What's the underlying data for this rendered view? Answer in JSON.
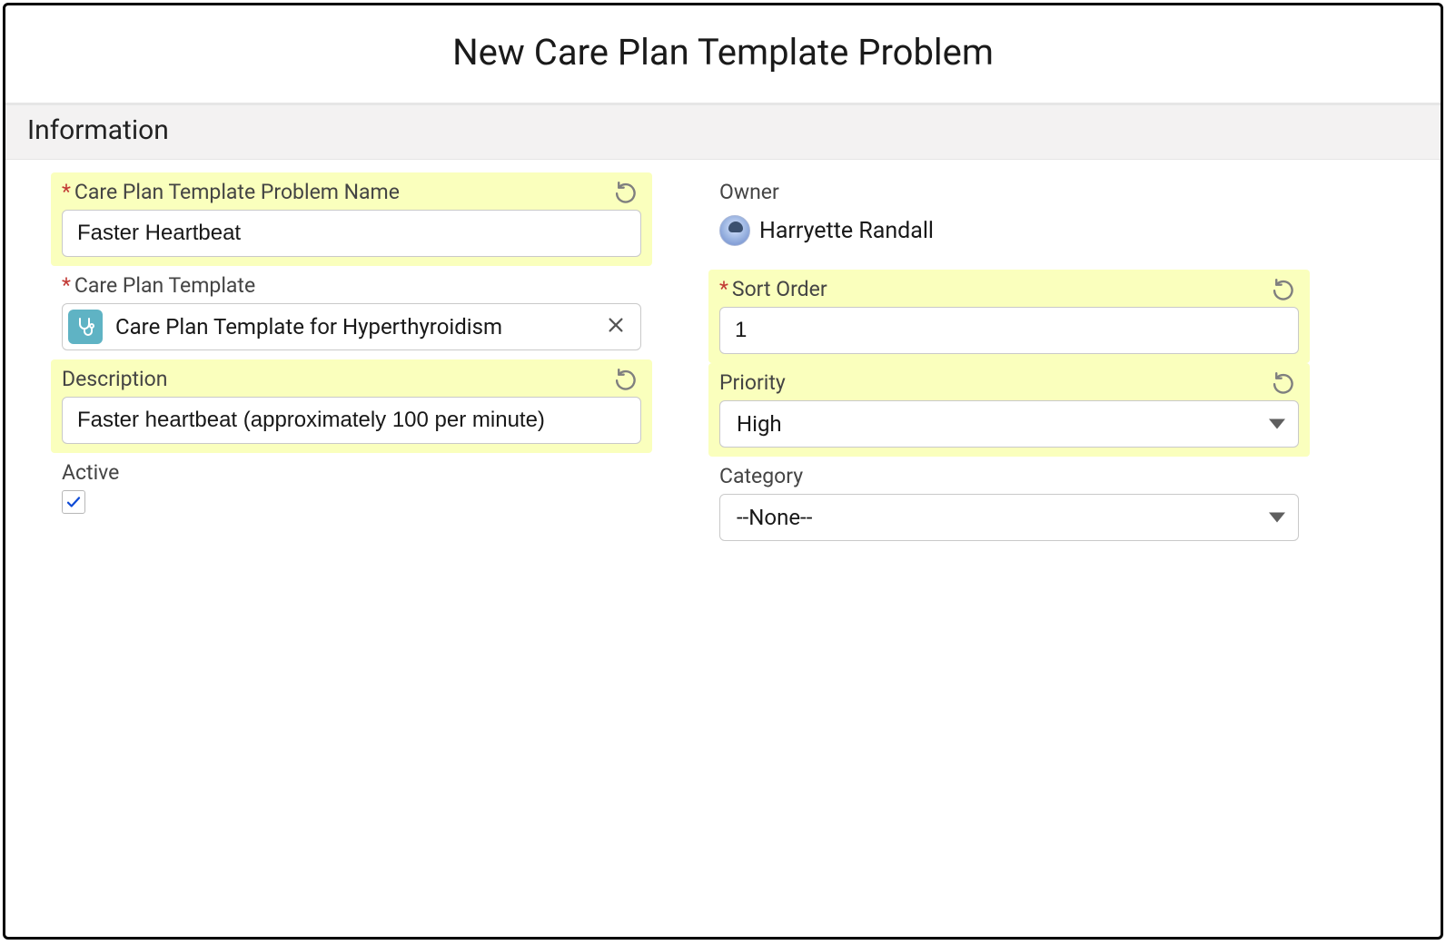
{
  "header": {
    "title": "New Care Plan Template Problem"
  },
  "section": {
    "information_label": "Information"
  },
  "left": {
    "problem_name": {
      "label": "Care Plan Template Problem Name",
      "value": "Faster Heartbeat"
    },
    "care_plan_template": {
      "label": "Care Plan Template",
      "value": "Care Plan Template for Hyperthyroidism"
    },
    "description": {
      "label": "Description",
      "value": "Faster heartbeat (approximately 100 per minute)"
    },
    "active": {
      "label": "Active",
      "checked": true
    }
  },
  "right": {
    "owner": {
      "label": "Owner",
      "value": "Harryette Randall"
    },
    "sort_order": {
      "label": "Sort Order",
      "value": "1"
    },
    "priority": {
      "label": "Priority",
      "value": "High"
    },
    "category": {
      "label": "Category",
      "value": "--None--"
    }
  }
}
